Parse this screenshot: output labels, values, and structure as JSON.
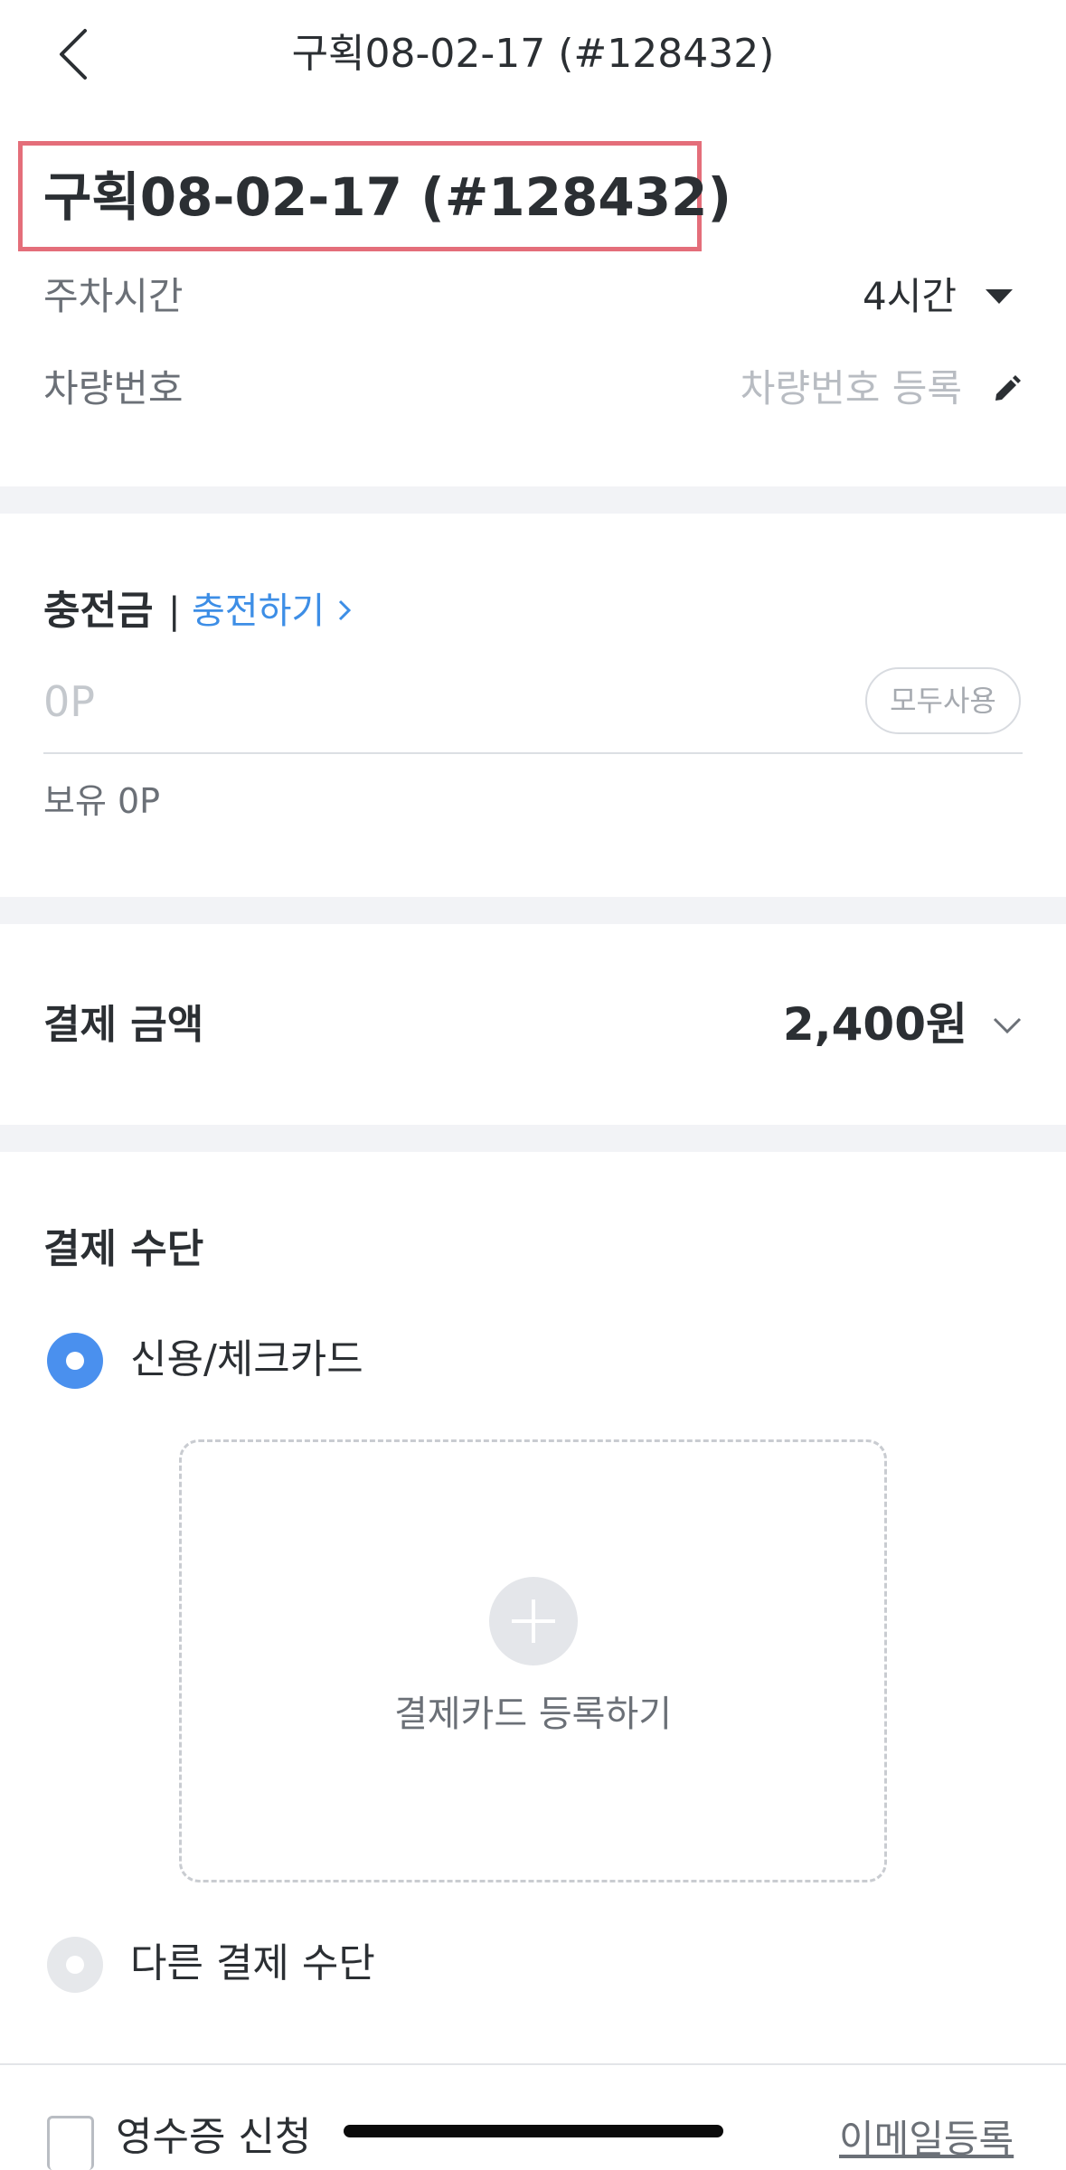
{
  "header": {
    "title": "구획08-02-17 (#128432)"
  },
  "lot": {
    "title": "구획08-02-17 (#128432)"
  },
  "parking": {
    "time_label": "주차시간",
    "time_value": "4시간",
    "plate_label": "차량번호",
    "plate_placeholder": "차량번호 등록"
  },
  "points": {
    "title": "충전금",
    "separator": "|",
    "charge_link": "충전하기",
    "input_placeholder": "0P",
    "use_all_label": "모두사용",
    "balance_text": "보유 0P"
  },
  "payment_amount": {
    "label": "결제 금액",
    "value": "2,400원"
  },
  "payment_method": {
    "title": "결제 수단",
    "options": [
      {
        "label": "신용/체크카드",
        "selected": true
      },
      {
        "label": "다른 결제 수단",
        "selected": false
      }
    ],
    "register_card_label": "결제카드 등록하기"
  },
  "receipt": {
    "label": "영수증 신청",
    "email_link": "이메일등록"
  },
  "colors": {
    "accent": "#4a90ee",
    "link": "#3d8ee6",
    "highlight_border": "#e46e7a"
  }
}
